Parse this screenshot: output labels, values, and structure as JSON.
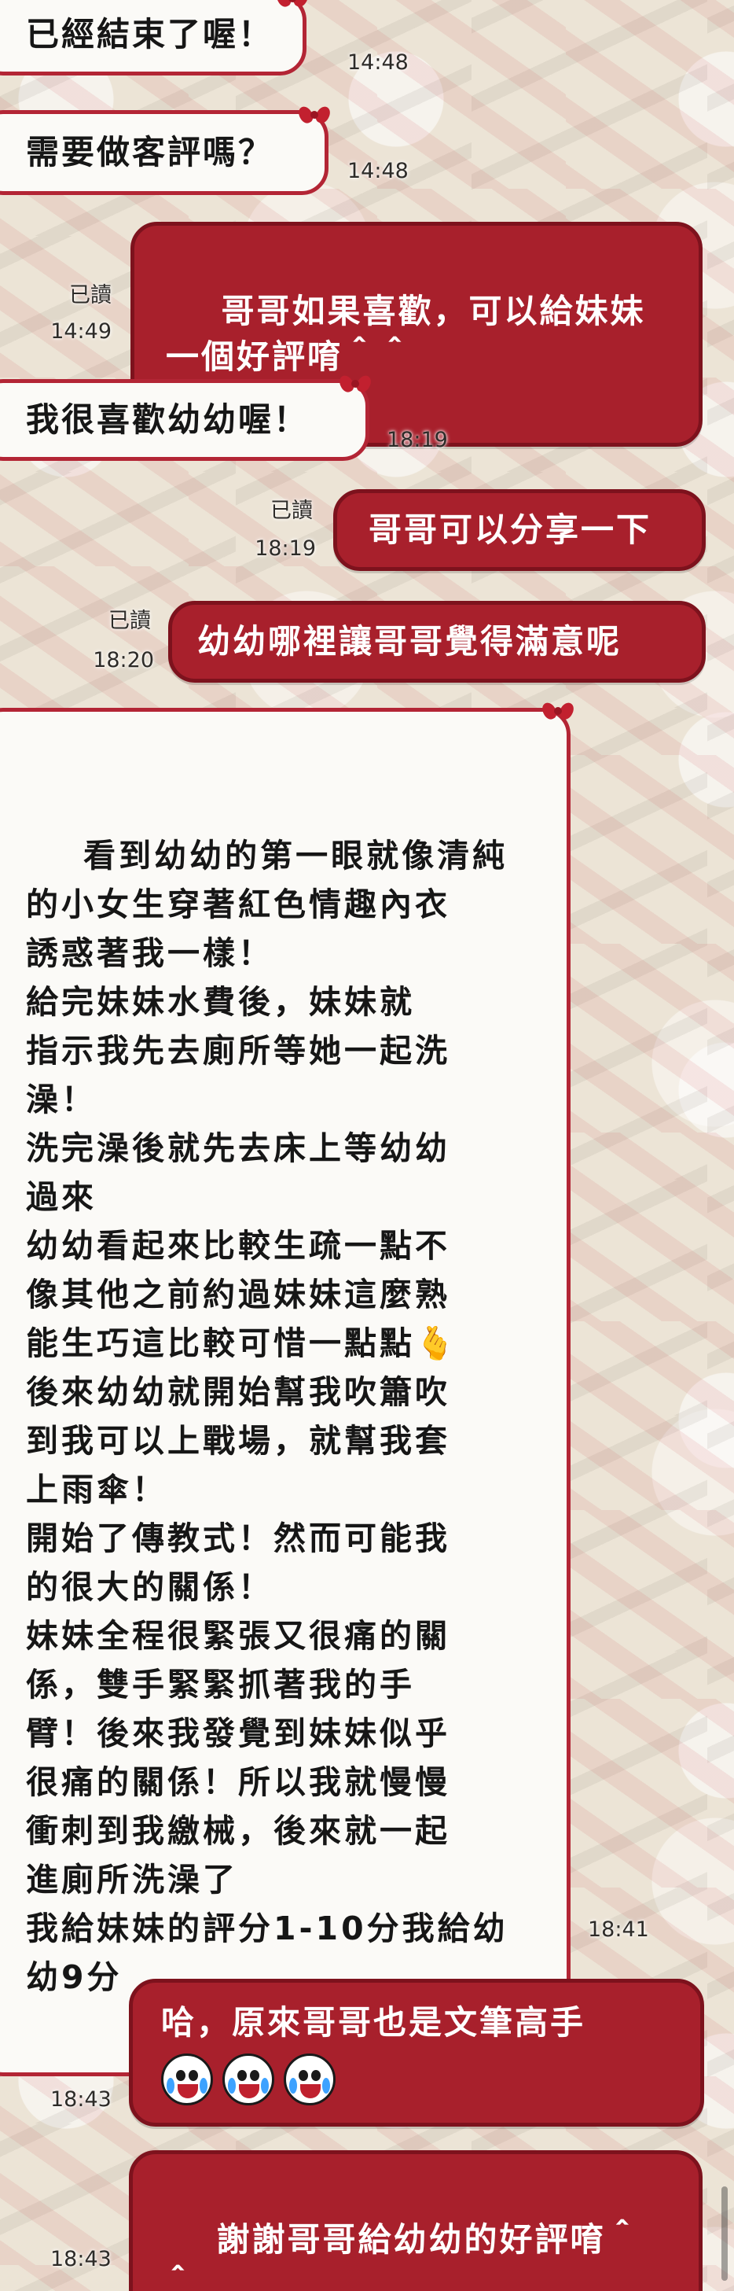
{
  "messages": [
    {
      "side": "in",
      "text": "已經結束了喔！",
      "time": "14:48"
    },
    {
      "side": "in",
      "text": "需要做客評嗎？",
      "time": "14:48"
    },
    {
      "side": "out",
      "text": "哥哥如果喜歡，可以給妹妹\n一個好評唷＾＾",
      "read": "已讀",
      "time": "14:49"
    },
    {
      "side": "in",
      "text": "我很喜歡幼幼喔！",
      "time": "18:19"
    },
    {
      "side": "out",
      "text": "哥哥可以分享一下",
      "read": "已讀",
      "time": "18:19"
    },
    {
      "side": "out",
      "text": "幼幼哪裡讓哥哥覺得滿意呢",
      "read": "已讀",
      "time": "18:20"
    },
    {
      "side": "in",
      "text": "看到幼幼的第一眼就像清純\n的小女生穿著紅色情趣內衣\n誘惑著我一樣！\n給完妹妹水費後，妹妹就\n指示我先去廁所等她一起洗\n澡！\n洗完澡後就先去床上等幼幼\n過來\n幼幼看起來比較生疏一點不\n像其他之前約過妹妹這麼熟\n能生巧這比較可惜一點點🫰\n後來幼幼就開始幫我吹簫吹\n到我可以上戰場，就幫我套\n上雨傘！\n開始了傳教式！然而可能我\n的很大的關係！\n妹妹全程很緊張又很痛的關\n係，雙手緊緊抓著我的手\n臂！後來我發覺到妹妹似乎\n很痛的關係！所以我就慢慢\n衝刺到我繳械，後來就一起\n進廁所洗澡了\n我給妹妹的評分1-10分我給幼\n幼9分",
      "time": "18:41"
    },
    {
      "side": "out",
      "text": "哈，原來哥哥也是文筆高手",
      "emoji": [
        "crying-laugh-emoji",
        "crying-laugh-emoji",
        "crying-laugh-emoji"
      ],
      "time": "18:43"
    },
    {
      "side": "out",
      "text": "謝謝哥哥給幼幼的好評唷＾\n＾",
      "time": "18:43"
    }
  ]
}
